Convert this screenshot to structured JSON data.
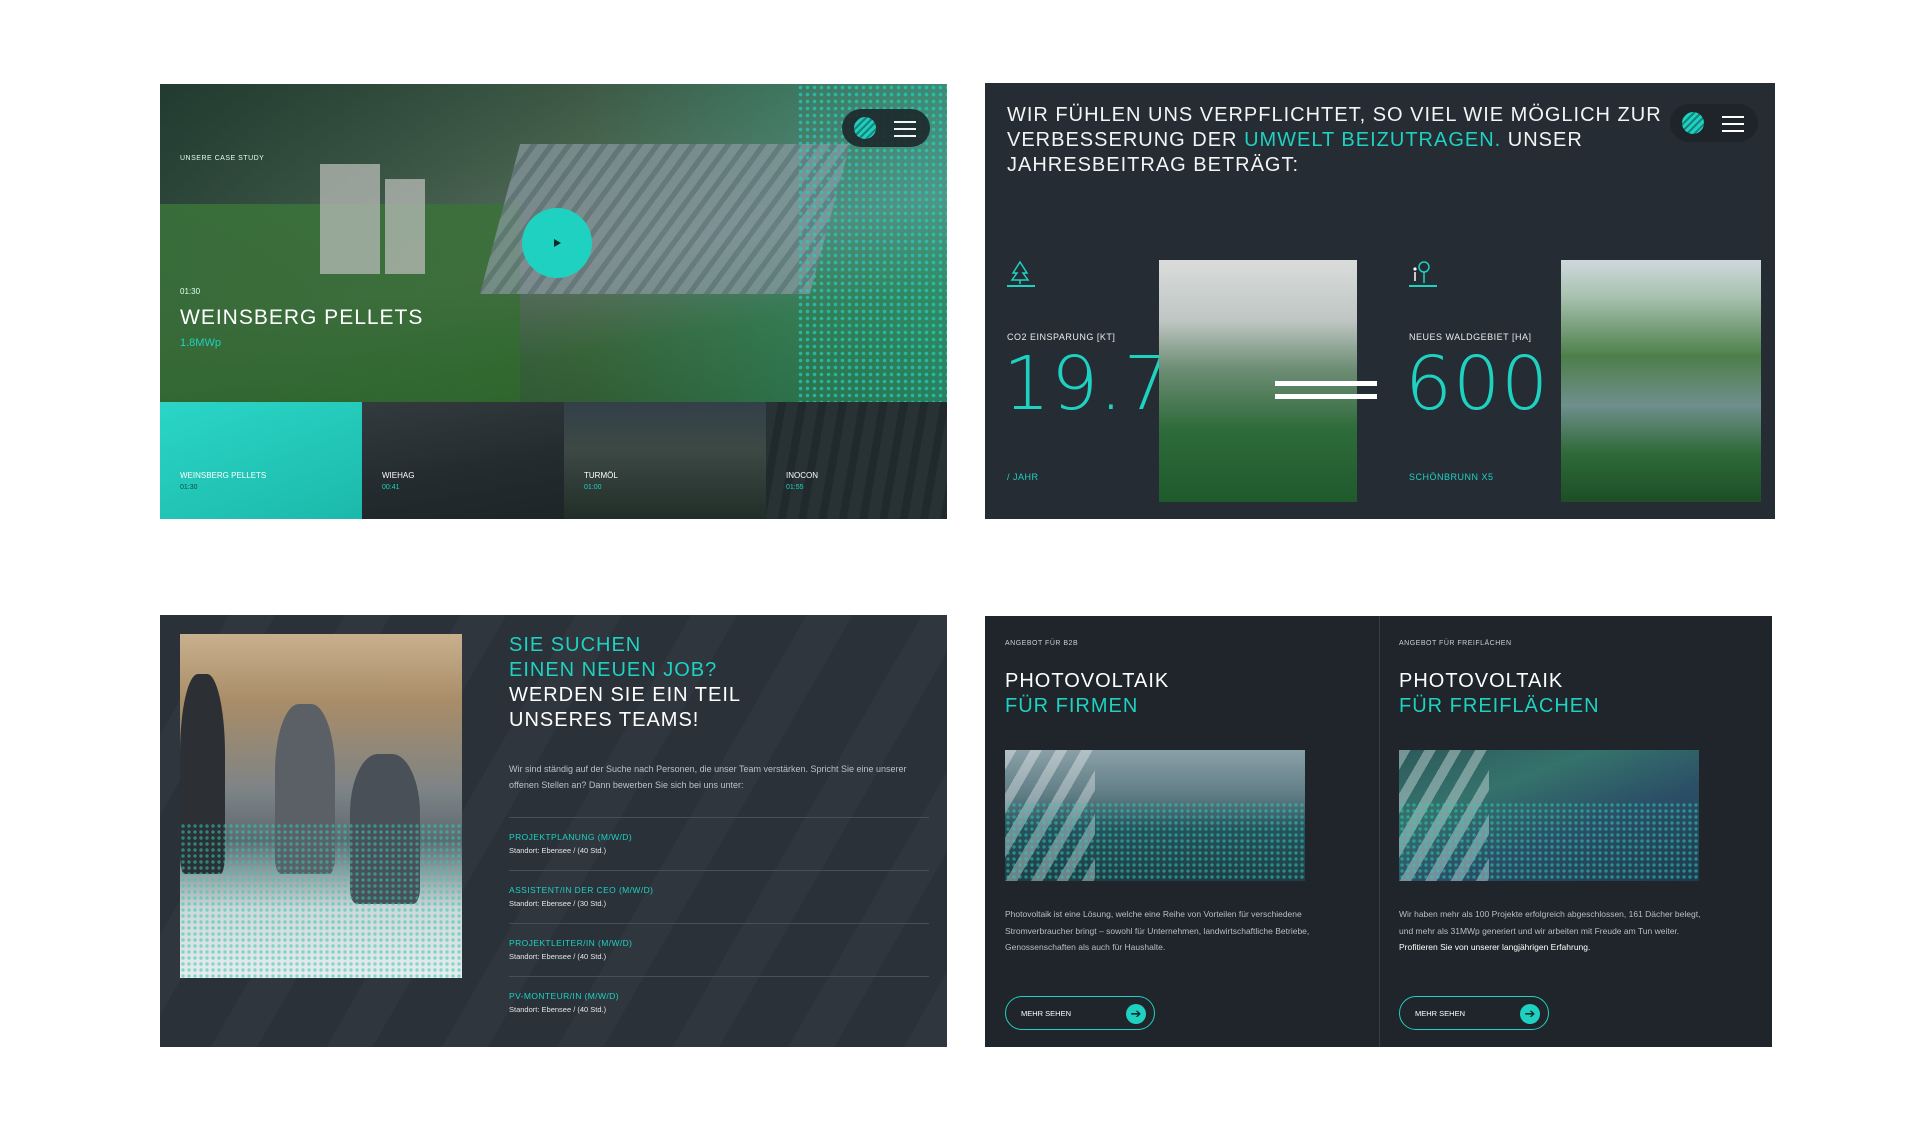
{
  "panel1": {
    "eyebrow": "UNSERE CASE STUDY",
    "time": "01:30",
    "title": "WEINSBERG PELLETS",
    "subtitle": "1.8MWp",
    "thumbs": [
      {
        "label": "WEINSBERG PELLETS",
        "time": "01:30"
      },
      {
        "label": "WIEHAG",
        "time": "00:41"
      },
      {
        "label": "TURMÖL",
        "time": "01:00"
      },
      {
        "label": "INOCON",
        "time": "01:55"
      }
    ]
  },
  "panel2": {
    "heading_part1": "WIR FÜHLEN UNS VERPFLICHTET, SO VIEL WIE MÖGLICH ZUR VERBESSERUNG DER ",
    "heading_highlight": "UMWELT BEIZUTRAGEN.",
    "heading_part2": " UNSER JAHRESBEITRAG BETRÄGT:",
    "stat1": {
      "label": "CO2 EINSPARUNG [KT]",
      "value": "19.7",
      "unit": "/ JAHR",
      "icon": "tree-icon"
    },
    "stat2": {
      "label": "NEUES WALDGEBIET [HA]",
      "value": "600",
      "unit": "SCHÖNBRUNN X5",
      "icon": "person-tree-icon"
    }
  },
  "panel3": {
    "heading_teal": [
      "SIE SUCHEN",
      "EINEN NEUEN JOB?"
    ],
    "heading_white": [
      "WERDEN SIE EIN TEIL",
      "UNSERES TEAMS!"
    ],
    "intro": "Wir sind ständig auf der Suche nach Personen, die unser Team verstärken. Spricht Sie eine unserer offenen Stellen an? Dann bewerben Sie sich bei uns unter:",
    "jobs": [
      {
        "title": "PROJEKTPLANUNG (M/W/D)",
        "location": "Standort: Ebensee / (40 Std.)"
      },
      {
        "title": "ASSISTENT/IN DER CEO (M/W/D)",
        "location": "Standort: Ebensee / (30 Std.)"
      },
      {
        "title": "PROJEKTLEITER/IN (M/W/D)",
        "location": "Standort: Ebensee / (40 Std.)"
      },
      {
        "title": "PV-MONTEUR/IN (M/W/D)",
        "location": "Standort: Ebensee / (40 Std.)"
      }
    ]
  },
  "panel4": {
    "left": {
      "eyebrow": "ANGEBOT FÜR B2B",
      "title_white": "PHOTOVOLTAIK",
      "title_teal": "FÜR FIRMEN",
      "text": "Photovoltaik ist eine Lösung, welche eine Reihe von Vorteilen für verschiedene Stromverbraucher bringt – sowohl für Unternehmen, landwirtschaftliche Betriebe, Genossenschaften als auch für Haushalte.",
      "button": "MEHR SEHEN"
    },
    "right": {
      "eyebrow": "ANGEBOT FÜR FREIFLÄCHEN",
      "title_white": "PHOTOVOLTAIK",
      "title_teal": "FÜR FREIFLÄCHEN",
      "text_part1": "Wir haben mehr als 100 Projekte erfolgreich abgeschlossen, 161 Dächer belegt, und mehr als 31MWp generiert und wir arbeiten mit Freude am Tun weiter. ",
      "text_bold": "Profitieren Sie von unserer langjährigen Erfahrung.",
      "button": "MEHR SEHEN"
    }
  },
  "colors": {
    "accent": "#1fd1c1",
    "dark": "#252c33"
  }
}
